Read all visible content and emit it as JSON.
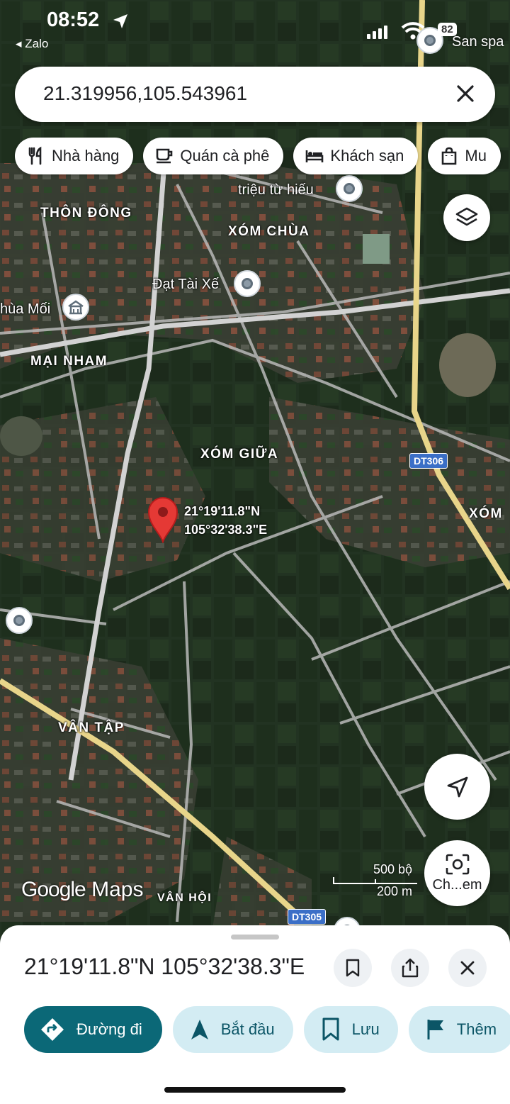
{
  "status_bar": {
    "time": "08:52",
    "back_app": "◂ Zalo",
    "battery_badge": "82",
    "edge_label": "San spa"
  },
  "search": {
    "query": "21.319956,105.543961"
  },
  "chips": [
    {
      "label": "Nhà hàng",
      "icon": "restaurant-icon"
    },
    {
      "label": "Quán cà phê",
      "icon": "coffee-icon"
    },
    {
      "label": "Khách sạn",
      "icon": "hotel-icon"
    },
    {
      "label": "Mu",
      "icon": "shopping-bag-icon"
    }
  ],
  "map": {
    "places": {
      "thon_dong": "THÔN ĐÔNG",
      "xom_chua": "XÓM CHÙA",
      "mai_nham": "MẠI NHAM",
      "xom_giua": "XÓM GIỮA",
      "xom_edge": "XÓM",
      "van_tap": "VÂN TẬP",
      "van_hoi": "VÂN HỘI"
    },
    "pois": {
      "trieu_tu_hieu": "triệu từ hiếu",
      "dat_tai_xe": "Đạt Tài Xế",
      "chua_moi": "hùa Mối"
    },
    "roads": {
      "dt306": "DT306",
      "dt305": "DT305"
    },
    "pin": {
      "lat": "21°19'11.8\"N",
      "lon": "105°32'38.3\"E"
    },
    "watermark_google": "Google",
    "watermark_maps": "Maps",
    "scale_top": "500 bộ",
    "scale_bottom": "200 m",
    "lens_label": "Ch...em"
  },
  "sheet": {
    "title": "21°19'11.8\"N 105°32'38.3\"E",
    "actions": [
      {
        "label": "Đường đi",
        "icon": "directions-icon"
      },
      {
        "label": "Bắt đầu",
        "icon": "navigation-arrow-icon"
      },
      {
        "label": "Lưu",
        "icon": "bookmark-icon"
      },
      {
        "label": "Thêm",
        "icon": "flag-icon"
      }
    ]
  },
  "colors": {
    "accent": "#0b6877",
    "action_bg": "#d3ecf3",
    "pin_red": "#e53935",
    "road_yellow": "#e8d58a",
    "shield_blue": "#3b6fc7"
  }
}
